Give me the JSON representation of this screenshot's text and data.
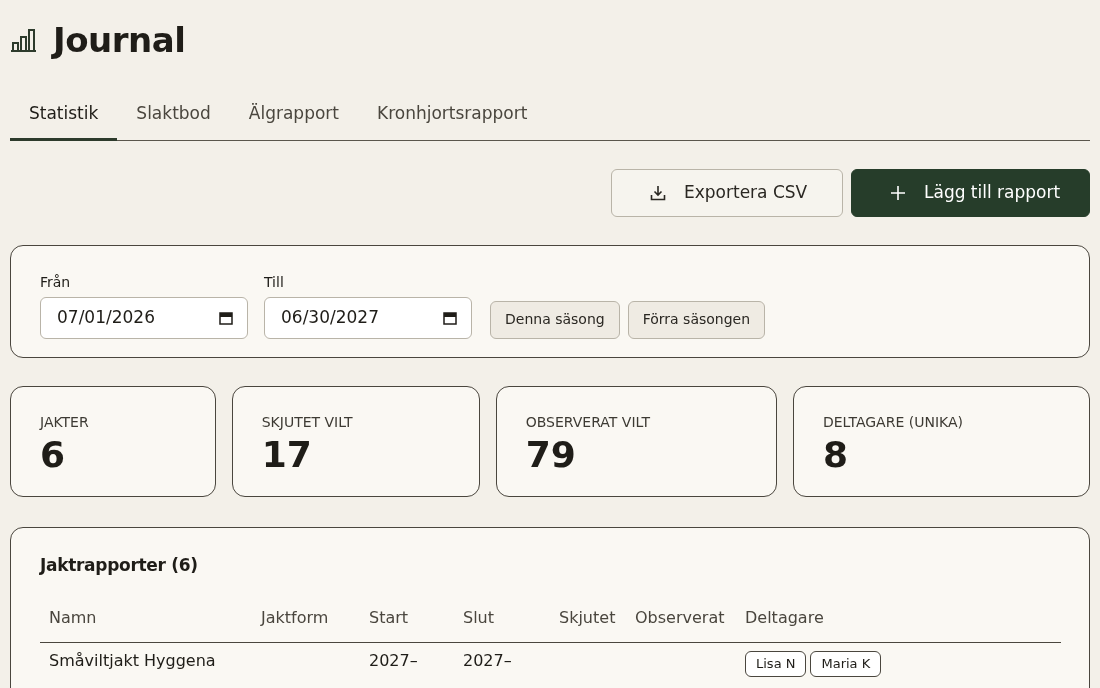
{
  "title": "Journal",
  "tabs": [
    {
      "label": "Statistik",
      "selected": true
    },
    {
      "label": "Slaktbod",
      "selected": false
    },
    {
      "label": "Älgrapport",
      "selected": false
    },
    {
      "label": "Kronhjortsrapport",
      "selected": false
    }
  ],
  "actions": {
    "export": "Exportera CSV",
    "add": "Lägg till rapport"
  },
  "filter": {
    "from_label": "Från",
    "from_value": "07/01/2026",
    "to_label": "Till",
    "to_value": "06/30/2027",
    "presets": [
      "Denna säsong",
      "Förra säsongen"
    ]
  },
  "stats": [
    {
      "label": "JAKTER",
      "value": "6"
    },
    {
      "label": "SKJUTET VILT",
      "value": "17"
    },
    {
      "label": "OBSERVERAT VILT",
      "value": "79"
    },
    {
      "label": "DELTAGARE (UNIKA)",
      "value": "8"
    }
  ],
  "table": {
    "title": "Jaktrapporter (6)",
    "columns": [
      "Namn",
      "Jaktform",
      "Start",
      "Slut",
      "Skjutet",
      "Observerat",
      "Deltagare"
    ],
    "rows": [
      {
        "name": "Småviltjakt Hyggena",
        "start": "2027–",
        "end": "2027–",
        "participants": [
          "Lisa N",
          "Maria K"
        ]
      }
    ]
  }
}
